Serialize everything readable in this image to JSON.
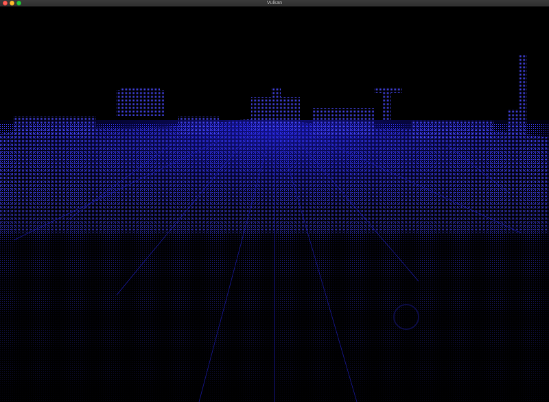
{
  "window": {
    "title": "Vulkan"
  },
  "titlebar_buttons": {
    "close": "close-icon",
    "minimize": "minimize-icon",
    "zoom": "zoom-icon"
  },
  "colors": {
    "background": "#000000",
    "point_color": "#2a2aff",
    "titlebar": "#333333"
  }
}
